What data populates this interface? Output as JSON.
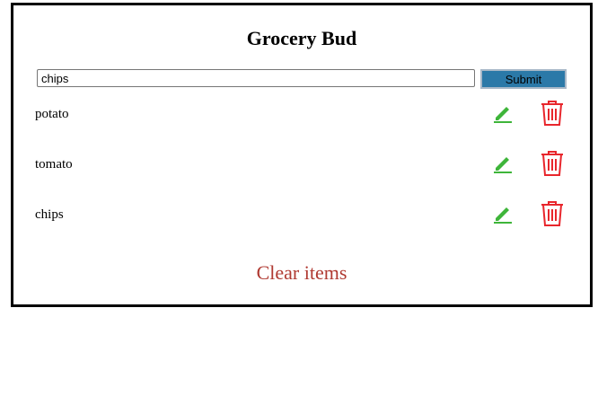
{
  "app": {
    "title": "Grocery Bud"
  },
  "form": {
    "input_value": "chips",
    "submit_label": "Submit"
  },
  "items": [
    {
      "name": "potato"
    },
    {
      "name": "tomato"
    },
    {
      "name": "chips"
    }
  ],
  "clear_label": "Clear items",
  "colors": {
    "edit_icon": "#3eb53a",
    "delete_icon": "#e8262c",
    "clear_text": "#b03a32",
    "submit_bg": "#2b79a8",
    "border": "#000000"
  },
  "icons": {
    "edit": "pencil-icon",
    "delete": "trash-icon"
  }
}
